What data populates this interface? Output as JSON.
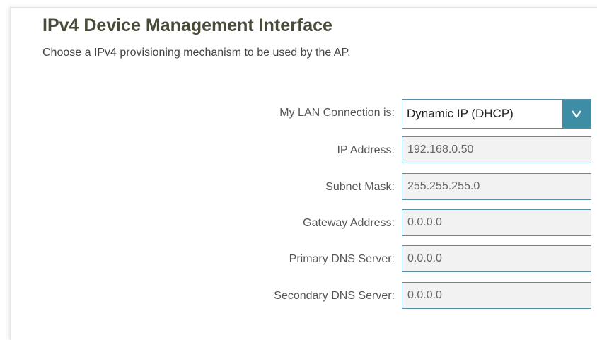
{
  "header": {
    "title": "IPv4 Device Management Interface",
    "subtitle": "Choose a IPv4 provisioning mechanism to be used by the AP."
  },
  "form": {
    "connection": {
      "label": "My LAN Connection is:",
      "selected": "Dynamic IP (DHCP)",
      "icon": "chevron-down-icon"
    },
    "ip_address": {
      "label": "IP Address:",
      "value": "192.168.0.50"
    },
    "subnet_mask": {
      "label": "Subnet Mask:",
      "value": "255.255.255.0"
    },
    "gateway": {
      "label": "Gateway Address:",
      "value": "0.0.0.0"
    },
    "primary_dns": {
      "label": "Primary DNS Server:",
      "value": "0.0.0.0"
    },
    "secondary_dns": {
      "label": "Secondary DNS Server:",
      "value": "0.0.0.0"
    }
  },
  "colors": {
    "accent": "#3d8da5",
    "field_border": "#5b8ea6",
    "field_bg": "#f2f2f2",
    "title": "#4a4a3a"
  }
}
